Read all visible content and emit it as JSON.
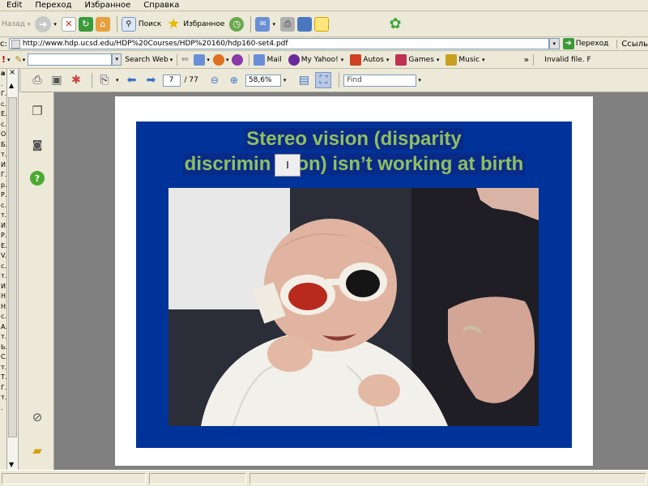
{
  "menu": {
    "items": [
      "Edit",
      "Переход",
      "Избранное",
      "Справка"
    ]
  },
  "toolbar": {
    "back_label": "Назад",
    "search_label": "Поиск",
    "favorites_label": "Избранное"
  },
  "address": {
    "label": "с:",
    "url": "http://www.hdp.ucsd.edu/HDP%20Courses/HDP%20160/hdp160-set4.pdf",
    "go_label": "Переход",
    "links_label": "Ссыль"
  },
  "linkbar": {
    "search_web": "Search Web",
    "links": [
      "Mail",
      "My Yahoo!",
      "Autos",
      "Games",
      "Music"
    ],
    "status_text": "Invalid file. F"
  },
  "left_panel": {
    "title": "а",
    "close": "×",
    "rows": [
      ".",
      "Г.",
      "с.",
      "Е.",
      "с.",
      "О.",
      "Б.",
      "т.",
      "И.",
      "Г.",
      "р.",
      "Р.",
      "с.",
      "т.",
      "И.",
      "Р.",
      "Е.",
      "V.",
      "с.",
      "т.",
      "И.",
      "Н.",
      "Н.",
      "с.",
      "А.",
      "т.",
      "Ь.",
      "С.",
      "т.",
      "Т.",
      "Г.",
      "т.",
      "."
    ]
  },
  "acrobat": {
    "page_current": "7",
    "page_total": "/ 77",
    "zoom": "58,6%",
    "find_placeholder": "Find"
  },
  "slide": {
    "title_line1": "Stereo vision (disparity",
    "title_line2_part1": "discrimin",
    "title_line2_part2": "on) isn’t working at birth"
  },
  "colors": {
    "slide_bg": "#003399",
    "title_text": "#8fbf5f",
    "doc_bg": "#808080",
    "chrome_bg": "#ece9d8"
  }
}
